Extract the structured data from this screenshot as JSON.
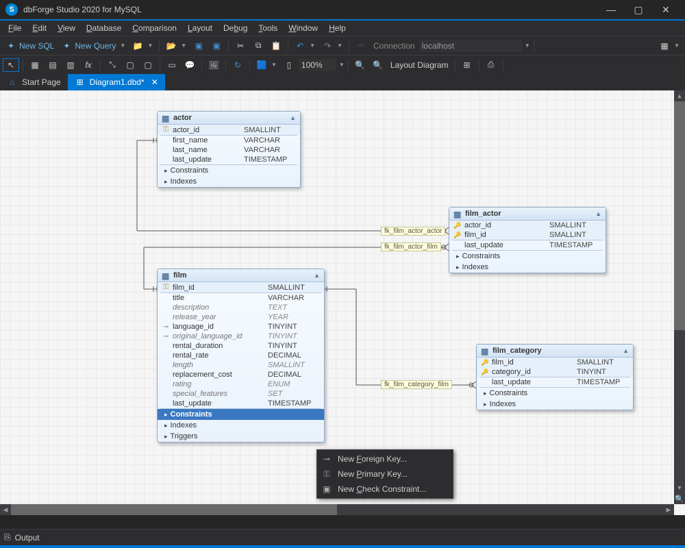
{
  "window": {
    "title": "dbForge Studio 2020 for MySQL"
  },
  "menu": [
    "File",
    "Edit",
    "View",
    "Database",
    "Comparison",
    "Layout",
    "Debug",
    "Tools",
    "Window",
    "Help"
  ],
  "toolbar1": {
    "new_sql": "New SQL",
    "new_query": "New Query",
    "connection_label": "Connection",
    "connection_value": "localhost"
  },
  "toolbar2": {
    "zoom": "100%",
    "layout_btn": "Layout Diagram"
  },
  "tabs": {
    "start": "Start Page",
    "diagram": "Diagram1.dbd*"
  },
  "entities": {
    "actor": {
      "name": "actor",
      "cols": [
        {
          "ic": "key",
          "n": "actor_id",
          "t": "SMALLINT",
          "pk": true
        },
        {
          "ic": "",
          "n": "first_name",
          "t": "VARCHAR"
        },
        {
          "ic": "",
          "n": "last_name",
          "t": "VARCHAR"
        },
        {
          "ic": "",
          "n": "last_update",
          "t": "TIMESTAMP"
        }
      ],
      "groups": [
        "Constraints",
        "Indexes"
      ]
    },
    "film_actor": {
      "name": "film_actor",
      "cols": [
        {
          "ic": "dblkey",
          "n": "actor_id",
          "t": "SMALLINT",
          "pk": true
        },
        {
          "ic": "dblkey",
          "n": "film_id",
          "t": "SMALLINT",
          "pk": true
        },
        {
          "ic": "",
          "n": "last_update",
          "t": "TIMESTAMP"
        }
      ],
      "groups": [
        "Constraints",
        "Indexes"
      ]
    },
    "film": {
      "name": "film",
      "cols": [
        {
          "ic": "key",
          "n": "film_id",
          "t": "SMALLINT",
          "pk": true
        },
        {
          "ic": "",
          "n": "title",
          "t": "VARCHAR"
        },
        {
          "ic": "",
          "n": "description",
          "t": "TEXT",
          "it": true
        },
        {
          "ic": "",
          "n": "release_year",
          "t": "YEAR",
          "it": true
        },
        {
          "ic": "fk",
          "n": "language_id",
          "t": "TINYINT"
        },
        {
          "ic": "fk",
          "n": "original_language_id",
          "t": "TINYINT",
          "it": true
        },
        {
          "ic": "",
          "n": "rental_duration",
          "t": "TINYINT"
        },
        {
          "ic": "",
          "n": "rental_rate",
          "t": "DECIMAL"
        },
        {
          "ic": "",
          "n": "length",
          "t": "SMALLINT",
          "it": true
        },
        {
          "ic": "",
          "n": "replacement_cost",
          "t": "DECIMAL"
        },
        {
          "ic": "",
          "n": "rating",
          "t": "ENUM",
          "it": true
        },
        {
          "ic": "",
          "n": "special_features",
          "t": "SET",
          "it": true
        },
        {
          "ic": "",
          "n": "last_update",
          "t": "TIMESTAMP"
        }
      ],
      "groups": [
        "Constraints",
        "Indexes",
        "Triggers"
      ],
      "selected_group": "Constraints"
    },
    "film_category": {
      "name": "film_category",
      "cols": [
        {
          "ic": "dblkey",
          "n": "film_id",
          "t": "SMALLINT",
          "pk": true
        },
        {
          "ic": "dblkey",
          "n": "category_id",
          "t": "TINYINT",
          "pk": true
        },
        {
          "ic": "",
          "n": "last_update",
          "t": "TIMESTAMP"
        }
      ],
      "groups": [
        "Constraints",
        "Indexes"
      ]
    }
  },
  "relations": {
    "r1": "fk_film_actor_actor",
    "r2": "fk_film_actor_film",
    "r3": "fk_film_category_film"
  },
  "ctxmenu": {
    "i1": "New Foreign Key...",
    "i2": "New Primary Key...",
    "i3": "New Check Constraint..."
  },
  "output": "Output"
}
